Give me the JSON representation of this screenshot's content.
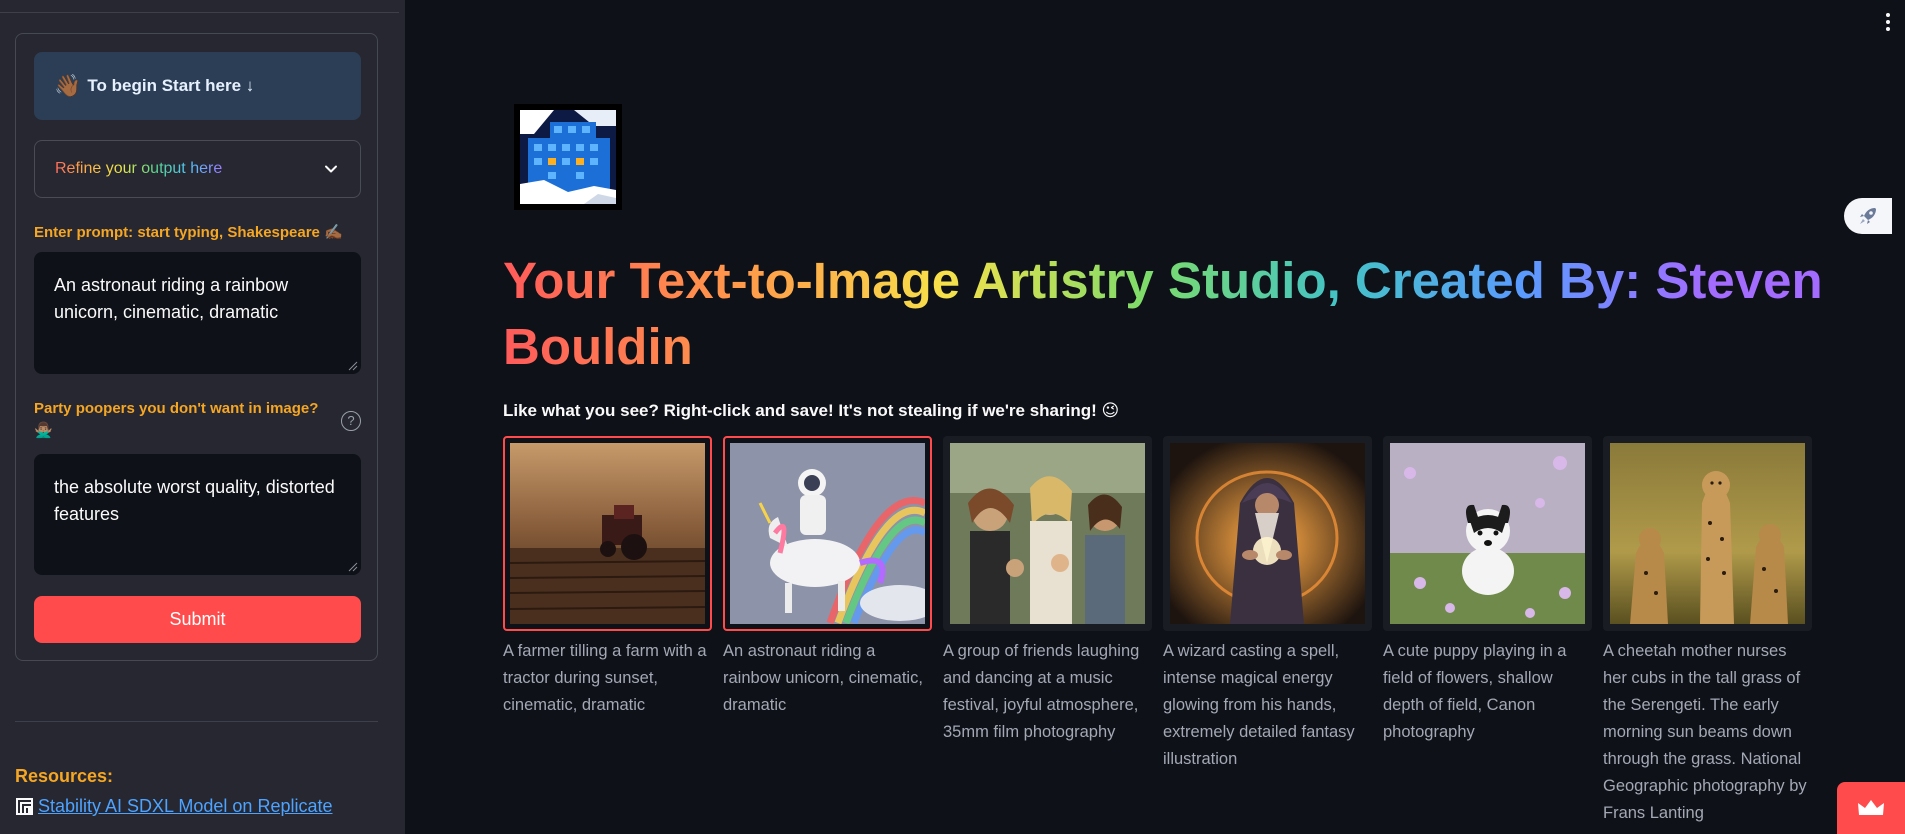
{
  "sidebar": {
    "start_label": "To begin Start here ↓",
    "start_emoji": "👋🏾",
    "refine_label": "Refine your output here",
    "prompt_label": "Enter prompt: start typing, Shakespeare ✍🏾",
    "prompt_value": "An astronaut riding a rainbow unicorn, cinematic, dramatic",
    "negative_label": "Party poopers you don't want in image? 🙅🏽‍♂️",
    "negative_value": "the absolute worst quality, distorted features",
    "help_symbol": "?",
    "submit_label": "Submit",
    "resources_title": "Resources:",
    "resource_link_text": "Stability AI SDXL Model on Replicate"
  },
  "main": {
    "title": "Your Text-to-Image Artistry Studio, Created By: Steven Bouldin",
    "subtitle": "Like what you see? Right-click and save! It's not stealing if we're sharing! 😉",
    "gallery": [
      {
        "caption": "A farmer tilling a farm with a tractor during sunset, cinematic, dramatic",
        "selected": true
      },
      {
        "caption": "An astronaut riding a rainbow unicorn, cinematic, dramatic",
        "selected": true
      },
      {
        "caption": "A group of friends laughing and dancing at a music festival, joyful atmosphere, 35mm film photography",
        "selected": false
      },
      {
        "caption": "A wizard casting a spell, intense magical energy glowing from his hands, extremely detailed fantasy illustration",
        "selected": false
      },
      {
        "caption": "A cute puppy playing in a field of flowers, shallow depth of field, Canon photography",
        "selected": false
      },
      {
        "caption": "A cheetah mother nurses her cubs in the tall grass of the Serengeti. The early morning sun beams down through the grass. National Geographic photography by Frans Lanting",
        "selected": false
      }
    ]
  },
  "colors": {
    "background": "#0e1117",
    "sidebar": "#262730",
    "accent": "#ff4b4b",
    "label_orange": "#f5a623",
    "link": "#4da3ff"
  }
}
